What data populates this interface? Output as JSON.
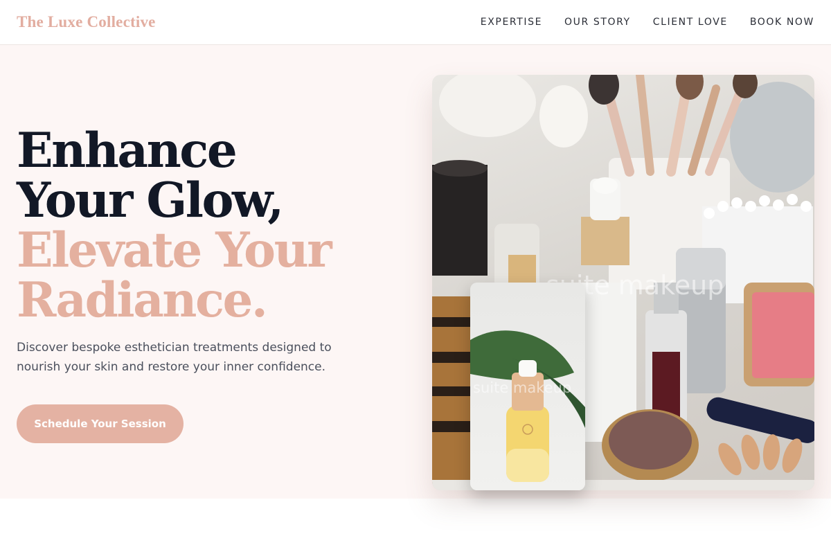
{
  "header": {
    "logo": "The Luxe Collective",
    "nav": [
      "EXPERTISE",
      "OUR STORY",
      "CLIENT LOVE",
      "BOOK NOW"
    ]
  },
  "hero": {
    "headline_line1": "Enhance Your Glow,",
    "headline_line2": "Elevate Your Radiance.",
    "subtext": "Discover bespoke esthetician treatments designed to nourish your skin and restore your inner confidence.",
    "cta": "Schedule Your Session",
    "image_watermark": "suite makeup",
    "inset_watermark": "suite makeup"
  },
  "colors": {
    "accent": "#e4b09f",
    "heading": "#121826",
    "hero_bg": "#fdf6f5"
  }
}
